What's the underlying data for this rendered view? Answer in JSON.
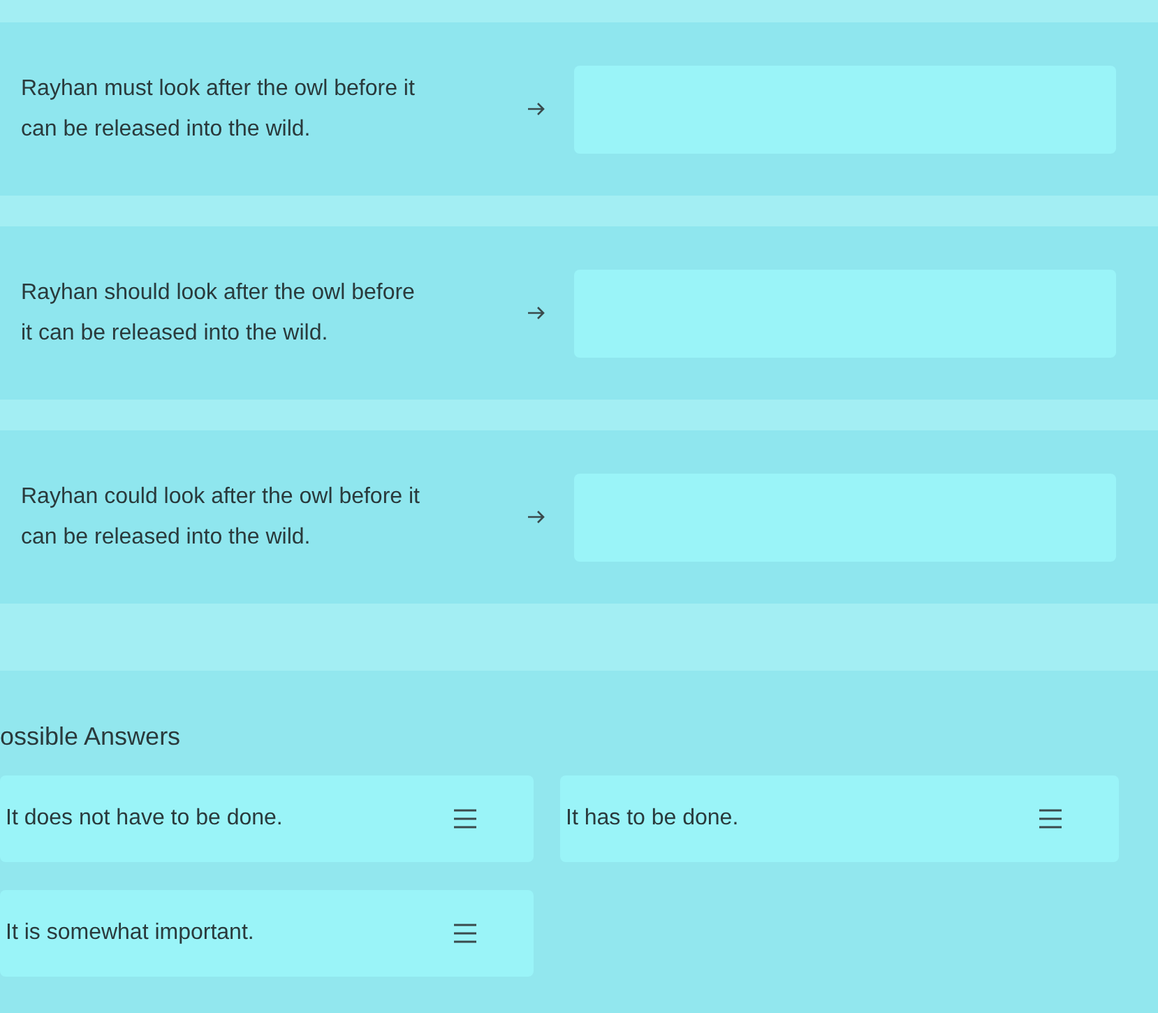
{
  "statements": [
    {
      "text": "Rayhan must look after the owl before it can be released into the wild."
    },
    {
      "text": "Rayhan should look after the owl before it can be released into the wild."
    },
    {
      "text": "Rayhan could look after the owl before it can be released into the wild."
    }
  ],
  "answers_section": {
    "title": "ossible Answers",
    "answers": [
      {
        "text": "It does not have to be done."
      },
      {
        "text": "It has to be done."
      },
      {
        "text": "It is somewhat important."
      }
    ]
  }
}
